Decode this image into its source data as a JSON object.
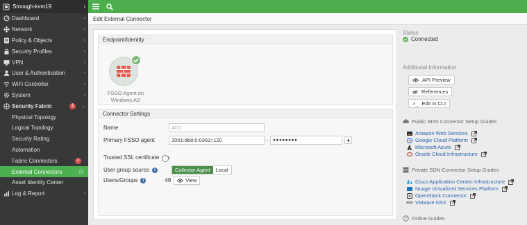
{
  "sidebar": {
    "device_name": "Smough-kvm19",
    "items": [
      {
        "label": "Dashboard",
        "icon": "dashboard-icon"
      },
      {
        "label": "Network",
        "icon": "network-icon"
      },
      {
        "label": "Policy & Objects",
        "icon": "policy-icon"
      },
      {
        "label": "Security Profiles",
        "icon": "lock-icon"
      },
      {
        "label": "VPN",
        "icon": "monitor-icon"
      },
      {
        "label": "User & Authentication",
        "icon": "user-icon"
      },
      {
        "label": "WiFi Controller",
        "icon": "wifi-icon"
      },
      {
        "label": "System",
        "icon": "gear-icon"
      },
      {
        "label": "Security Fabric",
        "badge": "1",
        "icon": "fabric-icon"
      }
    ],
    "sub_items": [
      {
        "label": "Physical Topology"
      },
      {
        "label": "Logical Topology"
      },
      {
        "label": "Security Rating"
      },
      {
        "label": "Automation"
      },
      {
        "label": "Fabric Connectors",
        "badge": "1"
      },
      {
        "label": "External Connectors"
      },
      {
        "label": "Asset Identity Center"
      }
    ],
    "last_item": {
      "label": "Log & Report",
      "icon": "chart-icon"
    }
  },
  "header": {
    "title": "Edit External Connector"
  },
  "endpoint": {
    "section_title": "Endpoint/Identity",
    "tile_label_line1": "FSSO Agent on",
    "tile_label_line2": "Windows AD"
  },
  "connector": {
    "section_title": "Connector Settings",
    "name_label": "Name",
    "name_placeholder": "AD1",
    "agent_label": "Primary FSSO agent",
    "agent_value": "2001:db8:0:0363::120",
    "agent_sep": "-",
    "password_value": "●●●●●●●●",
    "ssl_label": "Trusted SSL certificate",
    "group_label": "User group source",
    "group_opt_on": "Collector Agent",
    "group_opt_off": "Local",
    "users_label": "Users/Groups",
    "users_count": "49",
    "view_label": "View"
  },
  "right": {
    "status_title": "Status",
    "status_value": "Connected",
    "info_title": "Additional Information",
    "api_preview": "API Preview",
    "references": "References",
    "edit_cli": "Edit in CLI",
    "public_title": "Public SDN Connector Setup Guides",
    "public_links": [
      "Amazon Web Services",
      "Google Cloud Platform",
      "Microsoft Azure",
      "Oracle Cloud Infrastructure"
    ],
    "private_title": "Private SDN Connector Setup Guides",
    "private_links": [
      "Cisco Application Centric Infrastructure",
      "Nuage Virtualized Services Platform",
      "OpenStack Connector",
      "VMware NSX"
    ],
    "online_guides": "Online Guides"
  },
  "colors": {
    "accent": "#4cae4c",
    "sidebar": "#383838",
    "link": "#2a64b0",
    "badge": "#d9534f"
  }
}
